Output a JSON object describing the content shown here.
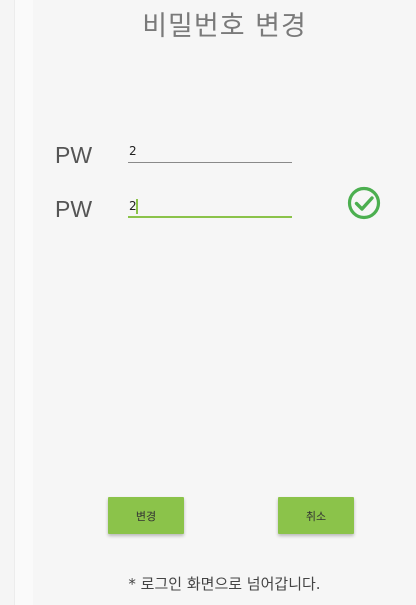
{
  "title": "비밀번호 변경",
  "fields": [
    {
      "label": "PW",
      "value": "2"
    },
    {
      "label": "PW",
      "value": "2"
    }
  ],
  "icons": {
    "match_check": "check-circle-icon"
  },
  "buttons": {
    "change": "변경",
    "cancel": "취소"
  },
  "notice": "* 로그인 화면으로 넘어갑니다.",
  "colors": {
    "accent": "#8bc34a",
    "check": "#4caf50"
  }
}
